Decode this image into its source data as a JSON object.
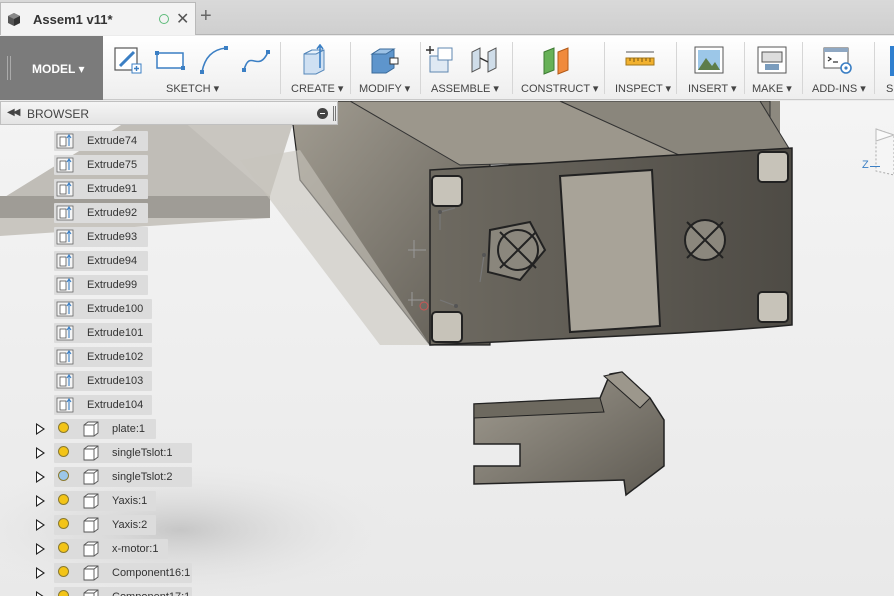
{
  "window": {
    "doc_tab_title": "Assem1 v11*",
    "new_tab_symbol": "+",
    "close_symbol": "✕"
  },
  "toolbar": {
    "workspace_label": "MODEL ▾",
    "groups": [
      {
        "label": "SKETCH ▾"
      },
      {
        "label": "CREATE ▾"
      },
      {
        "label": "MODIFY ▾"
      },
      {
        "label": "ASSEMBLE ▾"
      },
      {
        "label": "CONSTRUCT ▾"
      },
      {
        "label": "INSPECT ▾"
      },
      {
        "label": "INSERT ▾"
      },
      {
        "label": "MAKE ▾"
      },
      {
        "label": "ADD-INS ▾"
      },
      {
        "label": "S"
      }
    ]
  },
  "browser": {
    "title": "BROWSER",
    "bodies": [
      {
        "label": "Extrude74"
      },
      {
        "label": "Extrude75"
      },
      {
        "label": "Extrude91"
      },
      {
        "label": "Extrude92"
      },
      {
        "label": "Extrude93"
      },
      {
        "label": "Extrude94"
      },
      {
        "label": "Extrude99"
      },
      {
        "label": "Extrude100"
      },
      {
        "label": "Extrude101"
      },
      {
        "label": "Extrude102"
      },
      {
        "label": "Extrude103"
      },
      {
        "label": "Extrude104"
      }
    ],
    "components": [
      {
        "label": "plate:1",
        "bulb": "on"
      },
      {
        "label": "singleTslot:1",
        "bulb": "on"
      },
      {
        "label": "singleTslot:2",
        "bulb": "off"
      },
      {
        "label": "Yaxis:1",
        "bulb": "on"
      },
      {
        "label": "Yaxis:2",
        "bulb": "on"
      },
      {
        "label": "x-motor:1",
        "bulb": "on"
      },
      {
        "label": "Component16:1",
        "bulb": "on"
      },
      {
        "label": "Component17:1",
        "bulb": "on"
      }
    ]
  },
  "viewcube": {
    "axis_label": "Z"
  },
  "colors": {
    "accent_blue": "#2f7fcf",
    "model_button": "#7b7b7b",
    "bulb_on": "#f3c417",
    "bulb_off": "#9cc7e8",
    "metal": "#7a766d"
  }
}
